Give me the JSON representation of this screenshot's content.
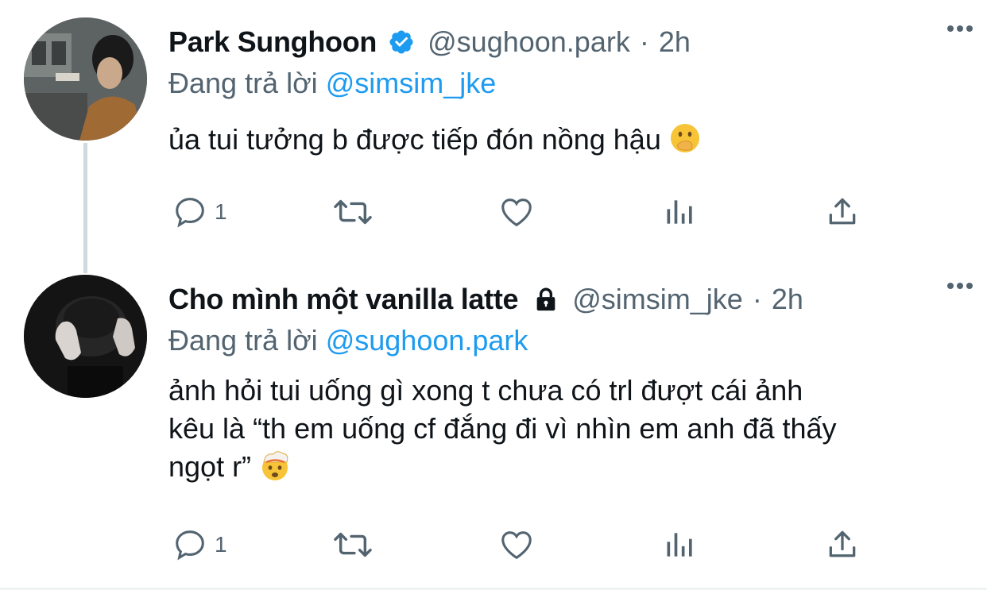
{
  "tweets": [
    {
      "name": "Park Sunghoon",
      "verified": true,
      "handle": "@sughoon.park",
      "separator": "·",
      "time": "2h",
      "replying_prefix": "Đang trả lời",
      "replying_to": "@simsim_jke",
      "text_lines": [
        "ủa tui tưởng b được tiếp đón nồng hậu"
      ],
      "emoji": "face-with-hand-over-mouth",
      "reply_count": "1"
    },
    {
      "name": "Cho mình một vanilla latte",
      "protected": true,
      "handle": "@simsim_jke",
      "separator": "·",
      "time": "2h",
      "replying_prefix": "Đang trả lời",
      "replying_to": "@sughoon.park",
      "text_lines": [
        "ảnh hỏi tui uống gì xong t chưa có trl đượt cái ảnh",
        "kêu là “th em uống cf đắng đi vì nhìn em anh đã thấy",
        "ngọt r”"
      ],
      "emoji": "exploding-head",
      "reply_count": "1"
    }
  ],
  "colors": {
    "accent": "#1d9bf0",
    "secondary": "#536471",
    "text": "#0f1419",
    "thread_line": "#cfd9de"
  }
}
